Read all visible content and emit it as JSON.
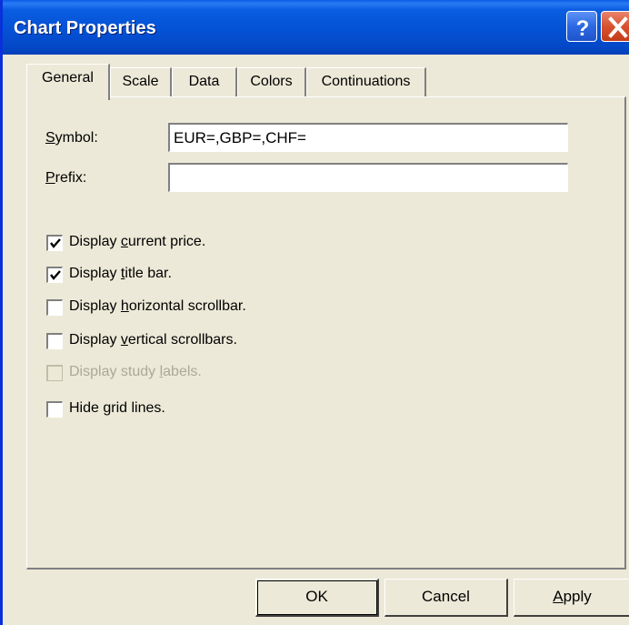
{
  "window": {
    "title": "Chart Properties",
    "title_bar_color": "#0553d6"
  },
  "titlebar_buttons": {
    "help_icon": "question-mark-icon",
    "close_icon": "close-x-icon"
  },
  "tabs": [
    {
      "label": "General",
      "active": true
    },
    {
      "label": "Scale",
      "active": false
    },
    {
      "label": "Data",
      "active": false
    },
    {
      "label": "Colors",
      "active": false
    },
    {
      "label": "Continuations",
      "active": false
    }
  ],
  "fields": {
    "symbol": {
      "label_pre": "",
      "label_ul": "S",
      "label_post": "ymbol:",
      "value": "EUR=,GBP=,CHF="
    },
    "prefix": {
      "label_pre": "",
      "label_ul": "P",
      "label_post": "refix:",
      "value": ""
    }
  },
  "options": [
    {
      "pre": "Display ",
      "ul": "c",
      "post": "urrent price.",
      "checked": true,
      "enabled": true
    },
    {
      "pre": "Display ",
      "ul": "t",
      "post": "itle bar.",
      "checked": true,
      "enabled": true
    },
    {
      "pre": "Display ",
      "ul": "h",
      "post": "orizontal scrollbar.",
      "checked": false,
      "enabled": true
    },
    {
      "pre": "Display ",
      "ul": "v",
      "post": "ertical scrollbars.",
      "checked": false,
      "enabled": true
    },
    {
      "pre": "Display study ",
      "ul": "l",
      "post": "abels.",
      "checked": false,
      "enabled": false
    },
    {
      "pre": "Hide ",
      "ul": "g",
      "post": "rid lines.",
      "checked": false,
      "enabled": true
    }
  ],
  "buttons": {
    "ok": "OK",
    "cancel": "Cancel",
    "apply_ul": "A",
    "apply_rest": "pply"
  }
}
